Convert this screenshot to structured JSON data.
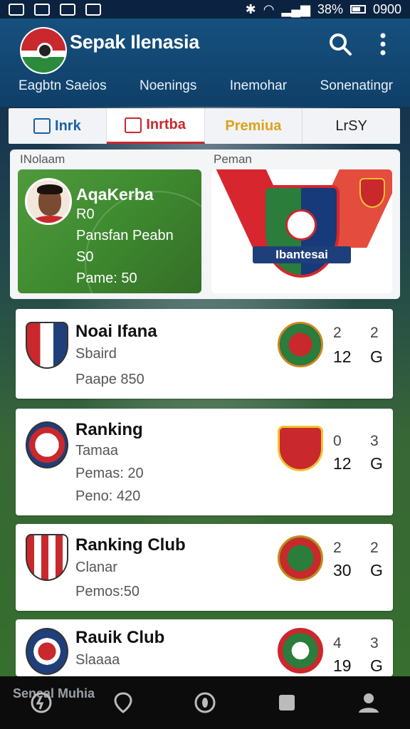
{
  "status_bar": {
    "battery": "38%",
    "time": "0900"
  },
  "header": {
    "title": "Sepak Ilenasia",
    "nav": [
      "Eagbtn Saeios",
      "Noenings",
      "Inemohar",
      "Sonenatingr"
    ]
  },
  "tabs": [
    {
      "label": "Inrk",
      "color": "#1a5fa8"
    },
    {
      "label": "Inrtba",
      "color": "#c9282d"
    },
    {
      "label": "Premiua",
      "color": "#e0a11b"
    },
    {
      "label": "LrSY",
      "color": "#222222"
    }
  ],
  "featured": {
    "left_label": "INolaam",
    "right_label": "Peman",
    "player": {
      "name": "AqaKerba",
      "line1": "R0",
      "line2": "Pansfan Peabn",
      "line3": "S0",
      "line4": "Pame: 50"
    },
    "club_banner": {
      "ribbon": "Ibantesai"
    }
  },
  "clubs": [
    {
      "name": "Noai Ifana",
      "sub1": "Sbaird",
      "sub2": "Paape 850",
      "score_top": [
        "2",
        "2"
      ],
      "score_bottom": [
        "12",
        "G"
      ]
    },
    {
      "name": "Ranking",
      "sub1": "Tamaa",
      "sub2": "Pemas: 20",
      "sub3": "Peno: 420",
      "score_top": [
        "0",
        "3"
      ],
      "score_bottom": [
        "12",
        "G"
      ]
    },
    {
      "name": "Ranking Club",
      "sub1": "Clanar",
      "sub2": "Pemos:50",
      "score_top": [
        "2",
        "2"
      ],
      "score_bottom": [
        "30",
        "G"
      ]
    },
    {
      "name": "Rauik Club",
      "sub1": "Slaaaa",
      "score_top": [
        "4",
        "3"
      ],
      "score_bottom": [
        "19",
        "G"
      ]
    }
  ],
  "bottom_bar": {
    "label": "Seneal Muhia"
  },
  "icons": {
    "search": "search-icon",
    "more": "more-vertical-icon",
    "nav": [
      "refresh-icon",
      "location-icon",
      "compass-icon",
      "square-icon",
      "profile-icon"
    ]
  },
  "colors": {
    "header": "#134a78",
    "accent_red": "#c9282d",
    "card_bg": "#ffffff",
    "premium": "#e0a11b"
  }
}
